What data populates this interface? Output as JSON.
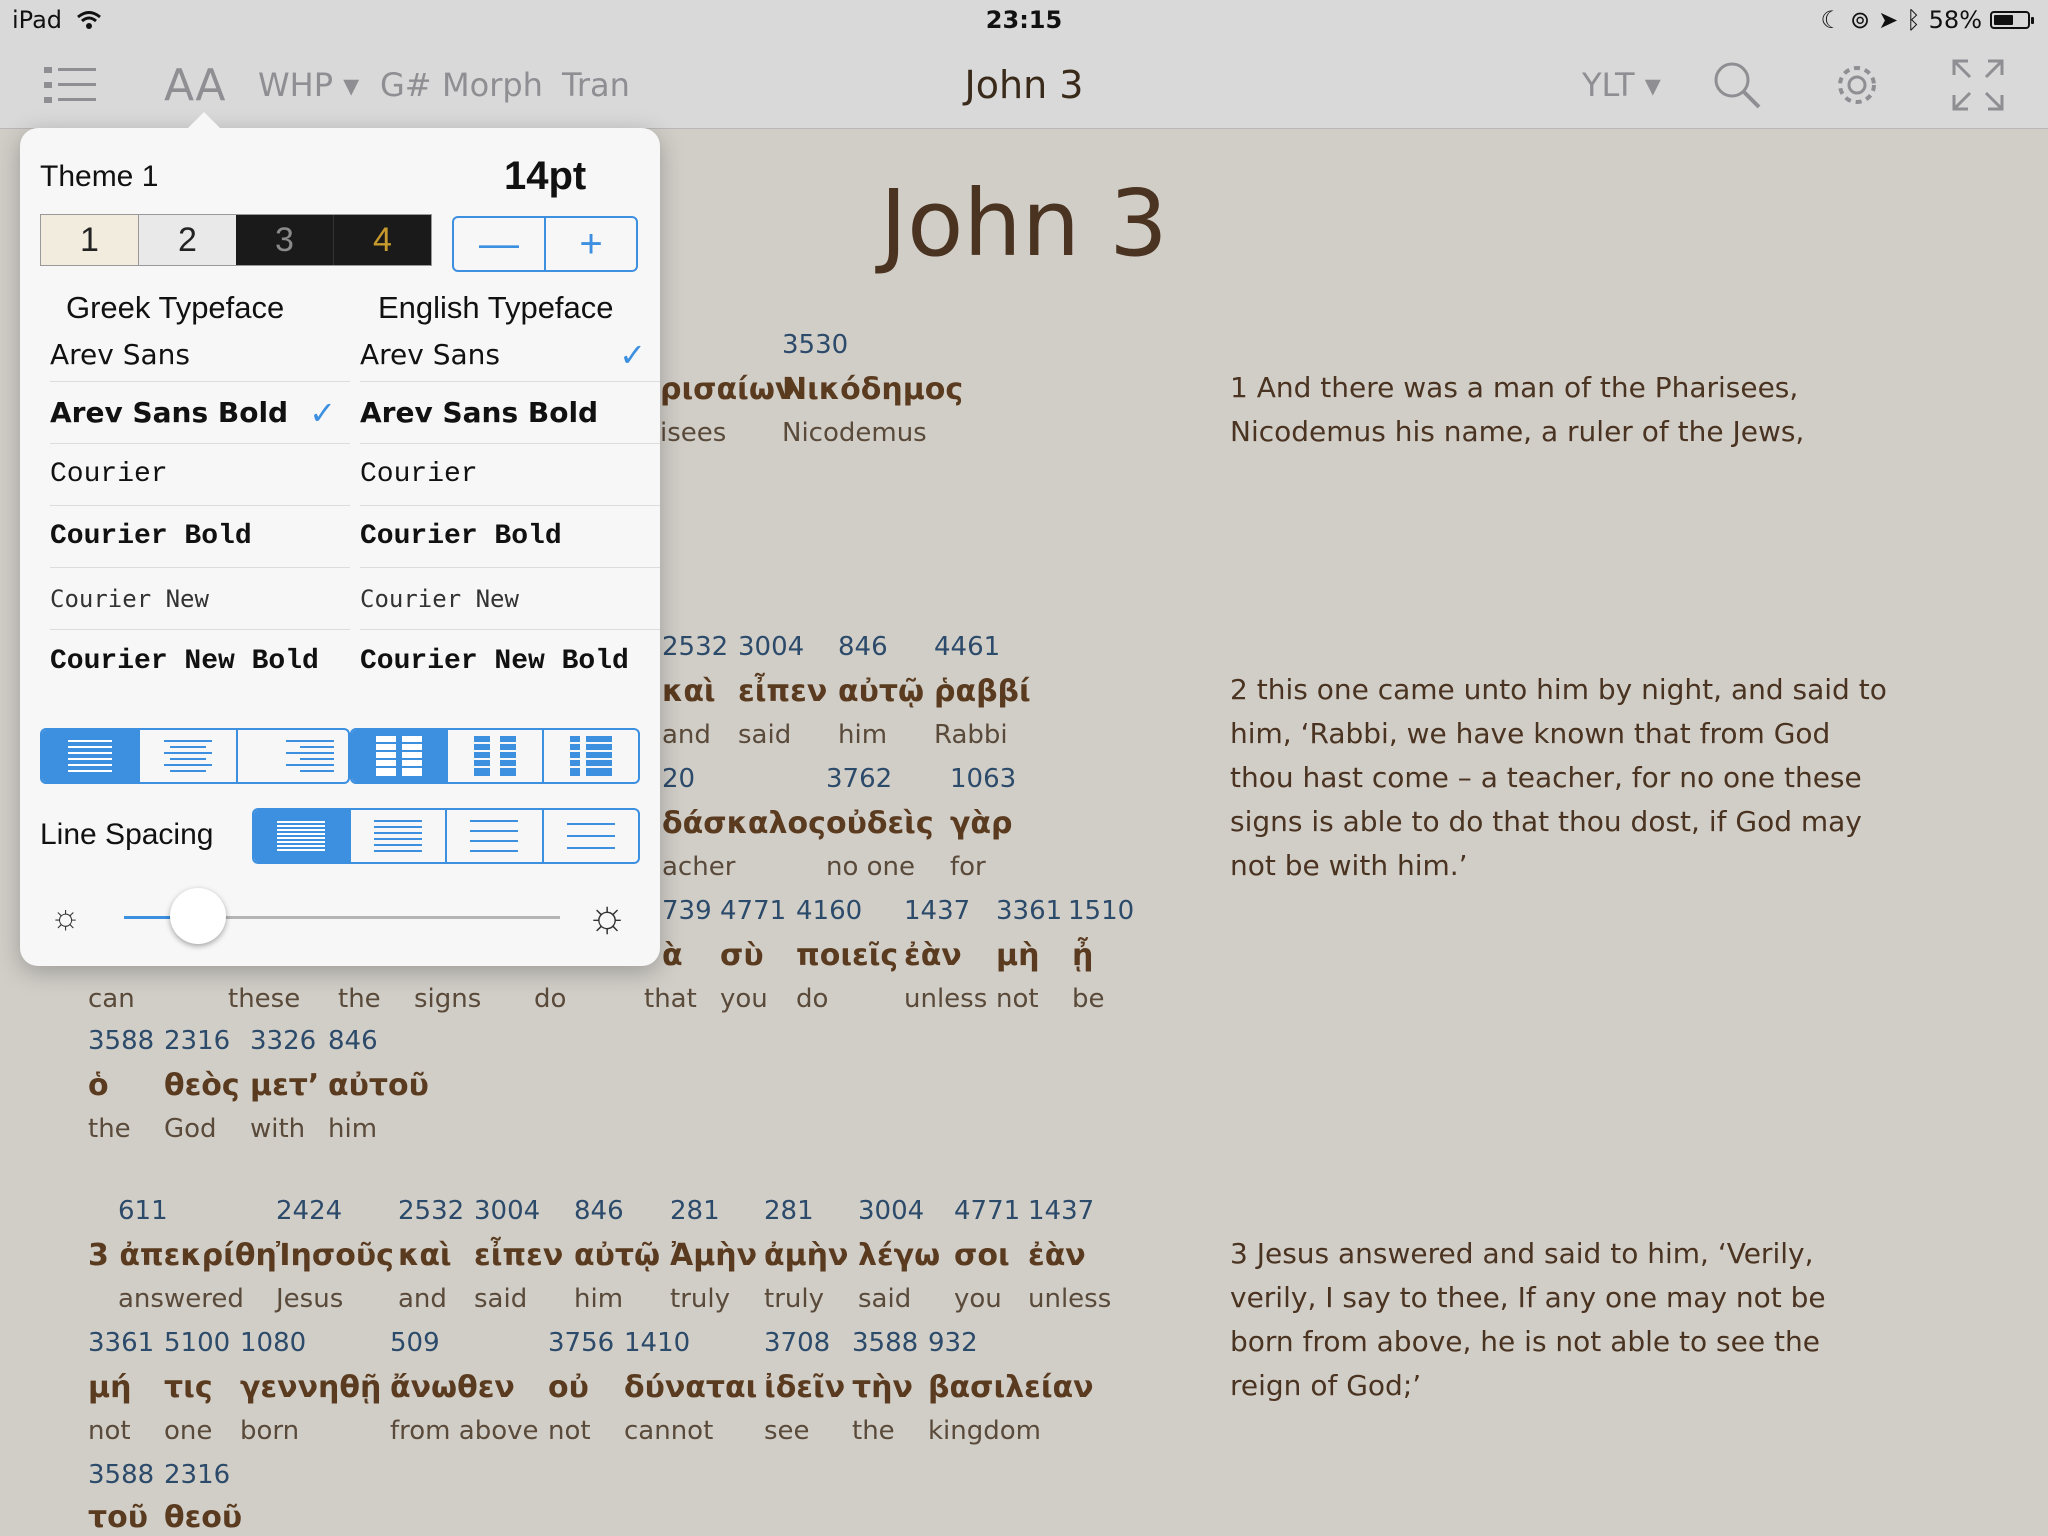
{
  "status": {
    "device": "iPad",
    "time": "23:15",
    "battery_text": "58%",
    "battery_level": 0.58
  },
  "toolbar": {
    "font_button": "AA",
    "source_text": "WHP ▾",
    "gnum": "G#",
    "morph": "Morph",
    "tran": "Tran",
    "title": "John 3",
    "version": "YLT ▾"
  },
  "heading": "John 3",
  "verse1": {
    "nums": [
      "3530"
    ],
    "greek": [
      "ρισαίων",
      "Νικόδημος"
    ],
    "eng": [
      "isees",
      "Nicodemus"
    ],
    "english": "1 And there was a man of the Pharisees, Nicodemus his name, a ruler of the Jews,"
  },
  "verse2": {
    "row1_nums": [
      "2532",
      "3004",
      "846",
      "4461"
    ],
    "row1_greek": [
      "καὶ",
      "εἶπεν",
      "αὐτῷ",
      "ῥαββί"
    ],
    "row1_eng": [
      "and",
      "said",
      "him",
      "Rabbi"
    ],
    "row2_nums": [
      "20",
      "3762",
      "1063"
    ],
    "row2_greek": [
      "δάσκαλος",
      "οὐδεὶς",
      "γὰρ"
    ],
    "row2_eng": [
      "acher",
      "no one",
      "for"
    ],
    "row3_nums": [
      "739",
      "4771",
      "4160",
      "1437",
      "3361",
      "1510"
    ],
    "row3_greek": [
      "ὰ",
      "σὺ",
      "ποιεῖς",
      "ἐὰν",
      "μὴ",
      "ᾖ"
    ],
    "row3_eng": [
      "can",
      "these",
      "the",
      "signs",
      "do",
      "that",
      "you",
      "do",
      "unless",
      "not",
      "be"
    ],
    "row4_nums": [
      "3588",
      "2316",
      "3326",
      "846"
    ],
    "row4_greek": [
      "ὁ",
      "θεὸς",
      "μετ’",
      "αὐτοῦ"
    ],
    "row4_eng": [
      "the",
      "God",
      "with",
      "him"
    ],
    "english": "2 this one came unto him by night, and said to him, ‘Rabbi, we have known that from God thou hast come – a teacher, for no one these signs is able to do that thou dost, if God may not be with him.’"
  },
  "verse3": {
    "row1_nums": [
      "611",
      "2424",
      "2532",
      "3004",
      "846",
      "281",
      "281",
      "3004",
      "4771",
      "1437"
    ],
    "row1_greek": [
      "3 ἀπεκρίθη",
      "Ἰησοῦς",
      "καὶ",
      "εἶπεν",
      "αὐτῷ",
      "Ἀμὴν",
      "ἀμὴν",
      "λέγω",
      "σοι",
      "ἐὰν"
    ],
    "row1_eng": [
      "answered",
      "Jesus",
      "and",
      "said",
      "him",
      "truly",
      "truly",
      "said",
      "you",
      "unless"
    ],
    "row2_nums": [
      "3361",
      "5100",
      "1080",
      "509",
      "3756",
      "1410",
      "3708",
      "3588",
      "932"
    ],
    "row2_greek": [
      "μή",
      "τις",
      "γεννηθῇ",
      "ἄνωθεν",
      "οὐ",
      "δύναται",
      "ἰδεῖν",
      "τὴν",
      "βασιλείαν"
    ],
    "row2_eng": [
      "not",
      "one",
      "born",
      "from above",
      "not",
      "cannot",
      "see",
      "the",
      "kingdom"
    ],
    "row3_nums": [
      "3588",
      "2316"
    ],
    "row3_greek": [
      "τοῦ",
      "θεοῦ"
    ],
    "english": "3 Jesus answered and said to him, ‘Verily, verily, I say to thee, If any one may not be born from above, he is not able to see the reign of God;’"
  },
  "popover": {
    "theme_label": "Theme 1",
    "font_size": "14pt",
    "themes": [
      "1",
      "2",
      "3",
      "4"
    ],
    "stepper_minus": "—",
    "stepper_plus": "+",
    "greek_header": "Greek Typeface",
    "english_header": "English Typeface",
    "greek_fonts": [
      "Arev Sans",
      "Arev Sans Bold",
      "Courier",
      "Courier Bold",
      "Courier New",
      "Courier New Bold"
    ],
    "english_fonts": [
      "Arev Sans",
      "Arev Sans Bold",
      "Courier",
      "Courier Bold",
      "Courier New",
      "Courier New Bold"
    ],
    "greek_selected": "Arev Sans Bold",
    "english_selected": "Arev Sans",
    "line_spacing_label": "Line Spacing",
    "brightness_level": 0.17
  },
  "colors": {
    "accent": "#3d8fe0",
    "page_bg": "#d1cec8",
    "greek_text": "#5a3b1f",
    "strong_nums": "#2c4a6a"
  }
}
